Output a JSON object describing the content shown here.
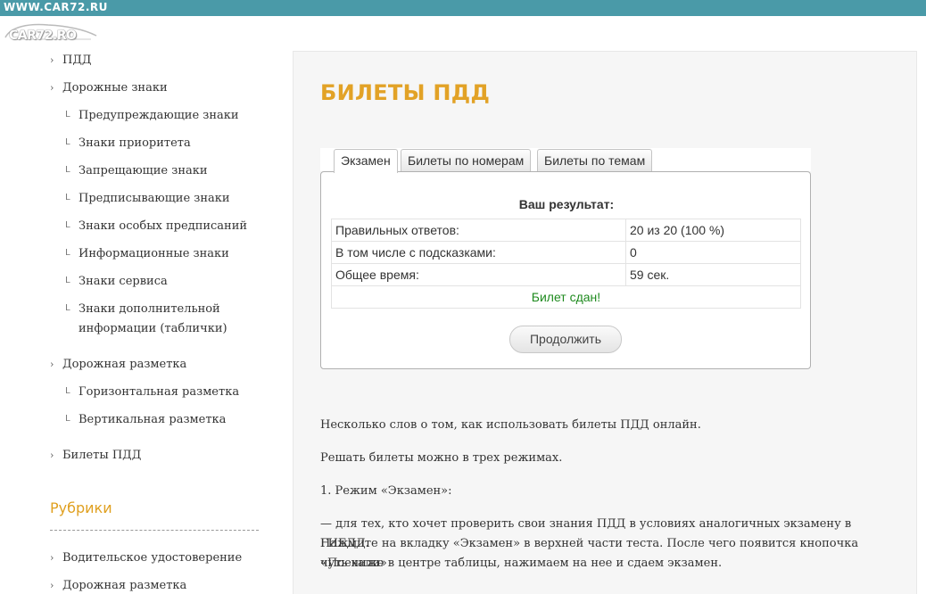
{
  "header": {
    "site_url": "WWW.CAR72.RU",
    "logo_text": "CAR72.RO"
  },
  "sidebar": {
    "items": [
      {
        "label": "ПДД",
        "level": 1
      },
      {
        "label": "Дорожные знаки",
        "level": 1
      },
      {
        "label": "Предупреждающие знаки",
        "level": 2
      },
      {
        "label": "Знаки приоритета",
        "level": 2
      },
      {
        "label": "Запрещающие знаки",
        "level": 2
      },
      {
        "label": "Предписывающие знаки",
        "level": 2
      },
      {
        "label": "Знаки особых предписаний",
        "level": 2
      },
      {
        "label": "Информационные знаки",
        "level": 2
      },
      {
        "label": "Знаки сервиса",
        "level": 2
      },
      {
        "label": "Знаки дополнительной",
        "label2": "информации (таблички)",
        "level": 2
      },
      {
        "label": "Дорожная разметка",
        "level": 1
      },
      {
        "label": "Горизонтальная разметка",
        "level": 2
      },
      {
        "label": "Вертикальная разметка",
        "level": 2
      },
      {
        "label": "Билеты ПДД",
        "level": 1
      }
    ],
    "rubrics_title": "Рубрики",
    "rubrics": [
      {
        "label": "Водительское удостоверение"
      },
      {
        "label": "Дорожная разметка"
      }
    ]
  },
  "main": {
    "title": "БИЛЕТЫ ПДД",
    "tabs": [
      {
        "label": "Экзамен",
        "active": true
      },
      {
        "label": "Билеты по номерам",
        "active": false
      },
      {
        "label": "Билеты по темам",
        "active": false
      }
    ],
    "result": {
      "heading": "Ваш результат:",
      "rows": [
        {
          "label": "Правильных ответов:",
          "value": "20 из 20 (100 %)"
        },
        {
          "label": "В том числе с подсказками:",
          "value": "0"
        },
        {
          "label": "Общее время:",
          "value": "59 сек."
        }
      ],
      "status": "Билет сдан!",
      "continue_label": "Продолжить"
    },
    "article": {
      "paragraphs": [
        "Несколько слов о том, как использовать билеты ПДД онлайн.",
        "Решать билеты можно в трех режимах.",
        "1. Режим «Экзамен»:"
      ],
      "body_lines": [
        "— для тех, кто хочет проверить свои знания ПДД в условиях аналогичных экзамену в ГИБДД.",
        "Нажмите на вкладку «Экзамен» в верхней части теста. После чего появится кнопочка «Поехали»",
        "чуть ниже в центре таблицы, нажимаем на нее и сдаем экзамен."
      ]
    }
  },
  "colors": {
    "topbar": "#4a9aa8",
    "title_accent": "#e2a226",
    "passed_text": "#1e8a1e"
  }
}
